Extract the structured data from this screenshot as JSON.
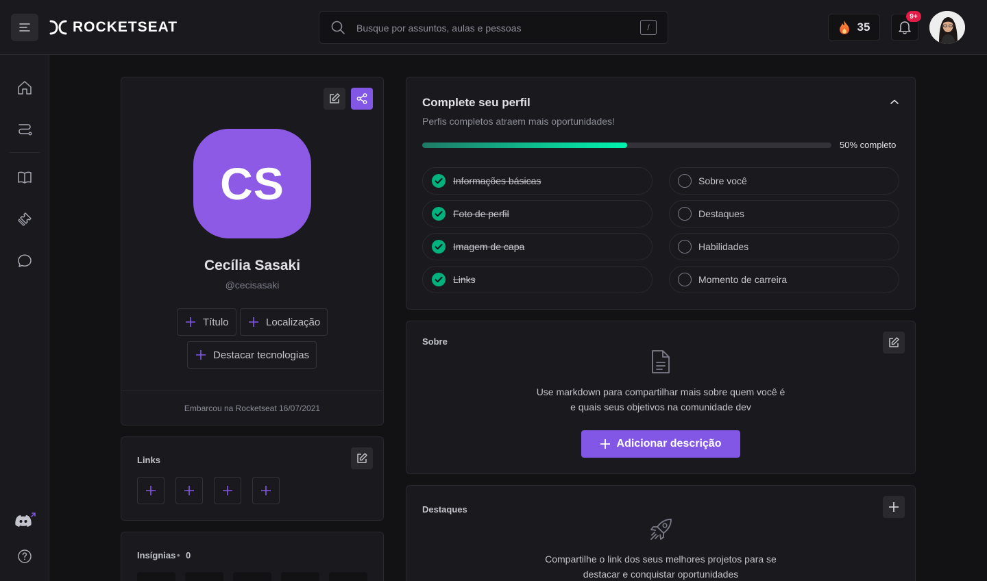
{
  "header": {
    "brand": "ROCKETSEAT",
    "search_placeholder": "Busque por assuntos, aulas e pessoas",
    "search_shortcut": "/",
    "streak_count": "35",
    "notifications_badge": "9+"
  },
  "sidebar": {
    "items": [
      "home-icon",
      "path-icon",
      "book-icon",
      "ticket-icon",
      "chat-icon",
      "discord-icon",
      "help-icon"
    ]
  },
  "profile": {
    "initials": "CS",
    "name": "Cecília Sasaki",
    "handle": "@cecisasaki",
    "chips": [
      "Título",
      "Localização",
      "Destacar tecnologias"
    ],
    "joined": "Embarcou na Rocketseat 16/07/2021",
    "avatar_color": "#8d5ae5"
  },
  "links_card": {
    "title": "Links",
    "slots": 4
  },
  "badges_card": {
    "title": "Insígnias",
    "separator": "•",
    "count": "0"
  },
  "complete": {
    "title": "Complete seu perfil",
    "subtitle": "Perfis completos atraem mais oportunidades!",
    "progress_percent": 50,
    "progress_label": "50% completo",
    "left_items": [
      {
        "label": "Informações básicas",
        "done": true
      },
      {
        "label": "Foto de perfil",
        "done": true
      },
      {
        "label": "Imagem de capa",
        "done": true
      },
      {
        "label": "Links",
        "done": true
      }
    ],
    "right_items": [
      {
        "label": "Sobre você",
        "done": false
      },
      {
        "label": "Destaques",
        "done": false
      },
      {
        "label": "Habilidades",
        "done": false
      },
      {
        "label": "Momento de carreira",
        "done": false
      }
    ]
  },
  "about": {
    "title": "Sobre",
    "text_line1": "Use markdown para compartilhar mais sobre quem você é",
    "text_line2": "e quais seus objetivos na comunidade dev",
    "button": "Adicionar descrição"
  },
  "highlights": {
    "title": "Destaques",
    "text_line1": "Compartilhe o link dos seus melhores projetos para se",
    "text_line2": "destacar e conquistar oportunidades"
  },
  "colors": {
    "accent": "#8257e5",
    "success": "#04d361",
    "background": "#121214",
    "surface": "#1a1a1e"
  }
}
